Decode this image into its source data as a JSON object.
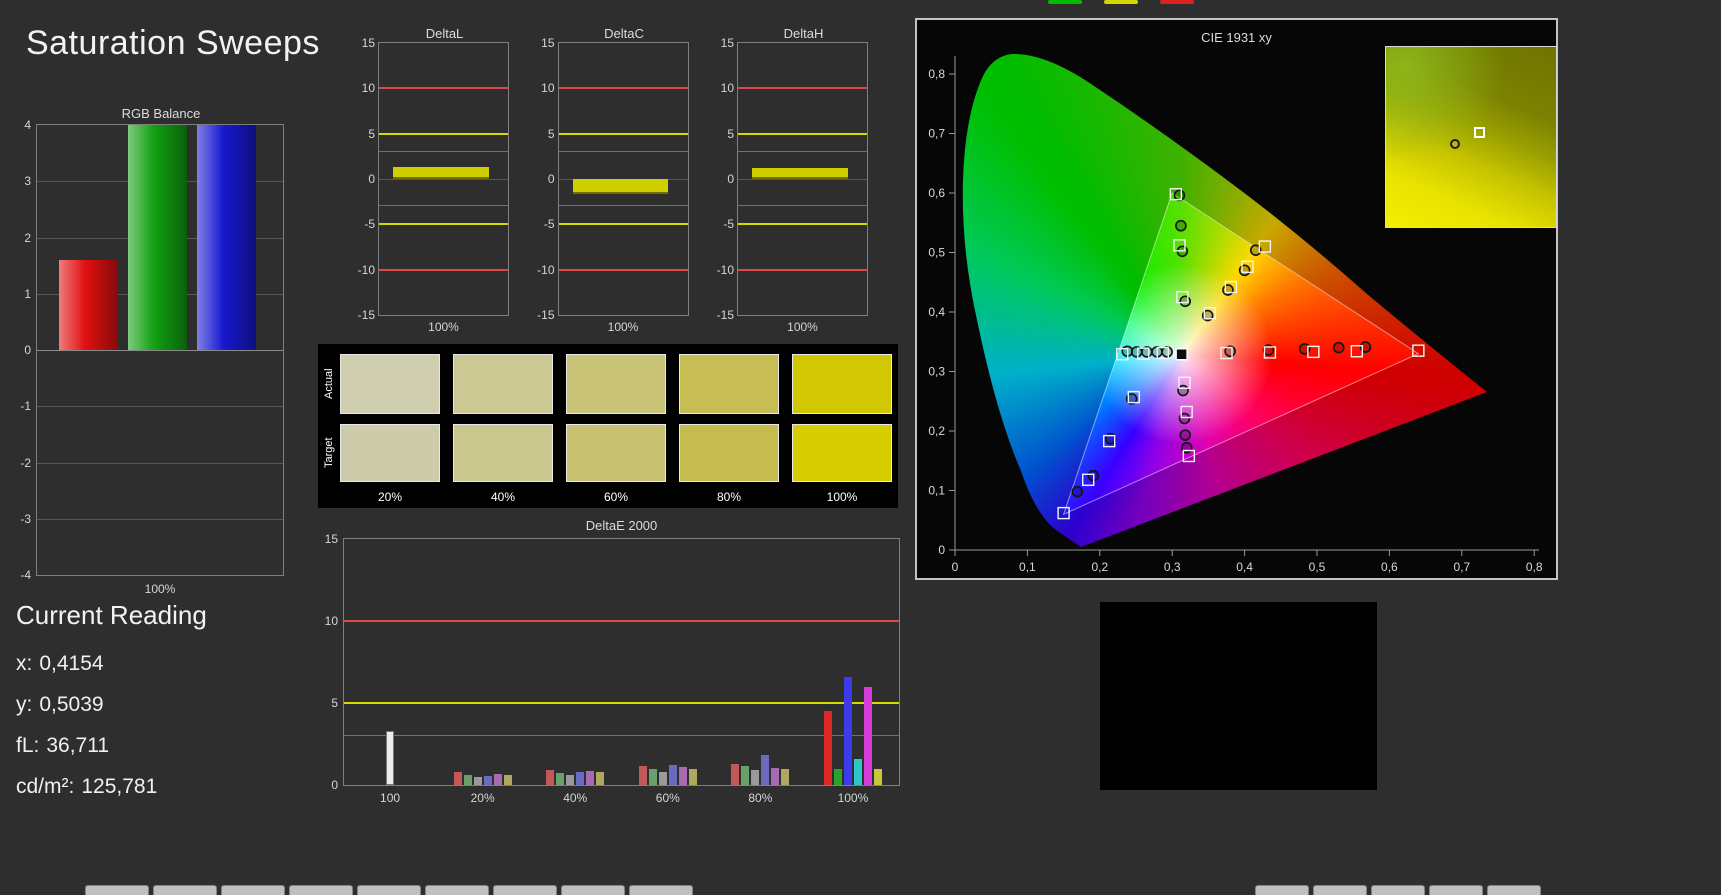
{
  "page": {
    "title": "Saturation Sweeps"
  },
  "legend_marks": [
    {
      "name": "green",
      "color": "#00bb00"
    },
    {
      "name": "yellow",
      "color": "#d6d600"
    },
    {
      "name": "red",
      "color": "#dd2222"
    }
  ],
  "chart_data": [
    {
      "id": "rgb-balance",
      "type": "bar",
      "title": "RGB Balance",
      "categories": [
        "Red",
        "Green",
        "Blue"
      ],
      "values": [
        1.6,
        4,
        4
      ],
      "bar_colors": [
        "#e01010",
        "#10a010",
        "#1818d0"
      ],
      "ylim": [
        -4,
        4
      ],
      "yticks": [
        4,
        3,
        2,
        1,
        0,
        -1,
        -2,
        -3,
        -4
      ],
      "xlabel": "100%"
    },
    {
      "id": "delta-l",
      "type": "bar",
      "title": "DeltaL",
      "categories": [
        "100%"
      ],
      "values": [
        1.3
      ],
      "bar_color": "#cfcf00",
      "ylim": [
        -15,
        15
      ],
      "yticks": [
        15,
        10,
        5,
        0,
        -5,
        -10,
        -15
      ],
      "ref_lines": [
        {
          "value": 10,
          "color": "#e04848"
        },
        {
          "value": -10,
          "color": "#e04848"
        },
        {
          "value": 5,
          "color": "#d8d800"
        },
        {
          "value": -5,
          "color": "#d8d800"
        },
        {
          "value": 3,
          "color": "#2fa02f"
        },
        {
          "value": -3,
          "color": "#2fa02f"
        }
      ],
      "xlabel": "100%"
    },
    {
      "id": "delta-c",
      "type": "bar",
      "title": "DeltaC",
      "categories": [
        "100%"
      ],
      "values": [
        -1.6
      ],
      "bar_color": "#cfcf00",
      "ylim": [
        -15,
        15
      ],
      "yticks": [
        15,
        10,
        5,
        0,
        -5,
        -10,
        -15
      ],
      "ref_lines": [
        {
          "value": 10,
          "color": "#e04848"
        },
        {
          "value": -10,
          "color": "#e04848"
        },
        {
          "value": 5,
          "color": "#d8d800"
        },
        {
          "value": -5,
          "color": "#d8d800"
        },
        {
          "value": 3,
          "color": "#2fa02f"
        },
        {
          "value": -3,
          "color": "#2fa02f"
        }
      ],
      "xlabel": "100%"
    },
    {
      "id": "delta-h",
      "type": "bar",
      "title": "DeltaH",
      "categories": [
        "100%"
      ],
      "values": [
        1.2
      ],
      "bar_color": "#cfcf00",
      "ylim": [
        -15,
        15
      ],
      "yticks": [
        15,
        10,
        5,
        0,
        -5,
        -10,
        -15
      ],
      "ref_lines": [
        {
          "value": 10,
          "color": "#e04848"
        },
        {
          "value": -10,
          "color": "#e04848"
        },
        {
          "value": 5,
          "color": "#d8d800"
        },
        {
          "value": -5,
          "color": "#d8d800"
        },
        {
          "value": 3,
          "color": "#2fa02f"
        },
        {
          "value": -3,
          "color": "#2fa02f"
        }
      ],
      "xlabel": "100%"
    },
    {
      "id": "deltae-2000",
      "type": "bar",
      "title": "DeltaE 2000",
      "ylim": [
        0,
        15
      ],
      "yticks": [
        15,
        10,
        5,
        0
      ],
      "ref_lines": [
        {
          "value": 10,
          "color": "#e04848"
        },
        {
          "value": 5,
          "color": "#d8d800"
        },
        {
          "value": 3,
          "color": "#2fa02f"
        }
      ],
      "groups": [
        {
          "label": "100",
          "bars": [
            {
              "color": "#ededed",
              "value": 3.3
            }
          ]
        },
        {
          "label": "20%",
          "bars": [
            {
              "color": "#c25858",
              "value": 0.8
            },
            {
              "color": "#6aa06a",
              "value": 0.6
            },
            {
              "color": "#9a9a9a",
              "value": 0.5
            },
            {
              "color": "#6a6ac0",
              "value": 0.55
            },
            {
              "color": "#a86ab0",
              "value": 0.7
            },
            {
              "color": "#b0a860",
              "value": 0.6
            }
          ]
        },
        {
          "label": "40%",
          "bars": [
            {
              "color": "#c25858",
              "value": 0.9
            },
            {
              "color": "#6aa06a",
              "value": 0.75
            },
            {
              "color": "#9a9a9a",
              "value": 0.6
            },
            {
              "color": "#6a6ac0",
              "value": 0.8
            },
            {
              "color": "#a86ab0",
              "value": 0.85
            },
            {
              "color": "#b0a860",
              "value": 0.8
            }
          ]
        },
        {
          "label": "60%",
          "bars": [
            {
              "color": "#c25858",
              "value": 1.15
            },
            {
              "color": "#6aa06a",
              "value": 1.0
            },
            {
              "color": "#9a9a9a",
              "value": 0.8
            },
            {
              "color": "#6a6ac0",
              "value": 1.25
            },
            {
              "color": "#a86ab0",
              "value": 1.1
            },
            {
              "color": "#b0a860",
              "value": 1.0
            }
          ]
        },
        {
          "label": "80%",
          "bars": [
            {
              "color": "#c25858",
              "value": 1.3
            },
            {
              "color": "#6aa06a",
              "value": 1.15
            },
            {
              "color": "#9a9a9a",
              "value": 0.9
            },
            {
              "color": "#6a6ac0",
              "value": 1.85
            },
            {
              "color": "#a86ab0",
              "value": 1.05
            },
            {
              "color": "#b0a860",
              "value": 0.95
            }
          ]
        },
        {
          "label": "100%",
          "bars": [
            {
              "color": "#dd2828",
              "value": 4.5
            },
            {
              "color": "#2aa42a",
              "value": 1.0
            },
            {
              "color": "#3c3cee",
              "value": 6.6
            },
            {
              "color": "#2cc8c8",
              "value": 1.6
            },
            {
              "color": "#d83cd8",
              "value": 6.0
            },
            {
              "color": "#c8c83c",
              "value": 1.0
            }
          ]
        }
      ]
    },
    {
      "id": "cie-1931",
      "type": "scatter",
      "title": "CIE 1931 xy",
      "xlim": [
        0,
        0.8
      ],
      "ylim": [
        0,
        0.8
      ],
      "xtick_labels": [
        "0",
        "0,1",
        "0,2",
        "0,3",
        "0,4",
        "0,5",
        "0,6",
        "0,7",
        "0,8"
      ],
      "ytick_labels": [
        "0",
        "0,1",
        "0,2",
        "0,3",
        "0,4",
        "0,5",
        "0,6",
        "0,7",
        "0,8"
      ],
      "gamut_triangle": [
        [
          0.64,
          0.33
        ],
        [
          0.3,
          0.6
        ],
        [
          0.15,
          0.06
        ]
      ],
      "white_point": [
        0.313,
        0.329
      ],
      "target_points": [
        [
          0.375,
          0.331
        ],
        [
          0.435,
          0.332
        ],
        [
          0.495,
          0.333
        ],
        [
          0.555,
          0.334
        ],
        [
          0.64,
          0.335
        ],
        [
          0.314,
          0.425
        ],
        [
          0.31,
          0.512
        ],
        [
          0.305,
          0.598
        ],
        [
          0.352,
          0.398
        ],
        [
          0.381,
          0.442
        ],
        [
          0.404,
          0.476
        ],
        [
          0.428,
          0.51
        ],
        [
          0.287,
          0.331
        ],
        [
          0.26,
          0.33
        ],
        [
          0.231,
          0.329
        ],
        [
          0.247,
          0.257
        ],
        [
          0.213,
          0.183
        ],
        [
          0.184,
          0.118
        ],
        [
          0.15,
          0.062
        ],
        [
          0.317,
          0.281
        ],
        [
          0.32,
          0.232
        ],
        [
          0.323,
          0.158
        ]
      ],
      "measured_points": [
        [
          0.38,
          0.334
        ],
        [
          0.433,
          0.336
        ],
        [
          0.483,
          0.338
        ],
        [
          0.53,
          0.34
        ],
        [
          0.567,
          0.341
        ],
        [
          0.318,
          0.418
        ],
        [
          0.314,
          0.502
        ],
        [
          0.312,
          0.545
        ],
        [
          0.31,
          0.596
        ],
        [
          0.349,
          0.394
        ],
        [
          0.377,
          0.437
        ],
        [
          0.4,
          0.47
        ],
        [
          0.4154,
          0.5039
        ],
        [
          0.293,
          0.333
        ],
        [
          0.279,
          0.333
        ],
        [
          0.265,
          0.333
        ],
        [
          0.251,
          0.333
        ],
        [
          0.238,
          0.334
        ],
        [
          0.244,
          0.254
        ],
        [
          0.215,
          0.187
        ],
        [
          0.191,
          0.125
        ],
        [
          0.169,
          0.098
        ],
        [
          0.315,
          0.268
        ],
        [
          0.317,
          0.221
        ],
        [
          0.318,
          0.193
        ],
        [
          0.32,
          0.172
        ]
      ]
    }
  ],
  "swatch_panel": {
    "row_labels": [
      "Actual",
      "Target"
    ],
    "column_labels": [
      "20%",
      "40%",
      "60%",
      "80%",
      "100%"
    ],
    "actual_colors": [
      "#cfceae",
      "#cbc893",
      "#c8c377",
      "#c6bd55",
      "#d2c703"
    ],
    "target_colors": [
      "#cdccaa",
      "#c9c68e",
      "#c7c170",
      "#c4bc4e",
      "#d8cd00"
    ]
  },
  "current_reading": {
    "heading": "Current Reading",
    "lines": [
      {
        "label": "x:",
        "value": "0,4154"
      },
      {
        "label": "y:",
        "value": "0,5039"
      },
      {
        "label": "fL:",
        "value": "36,711"
      },
      {
        "label": "cd/m²:",
        "value": "125,781"
      }
    ]
  },
  "bottom_tabs": {
    "left": [
      "",
      "",
      "",
      "",
      "",
      "",
      "",
      "",
      ""
    ],
    "right": [
      "",
      "",
      "",
      "",
      ""
    ]
  }
}
